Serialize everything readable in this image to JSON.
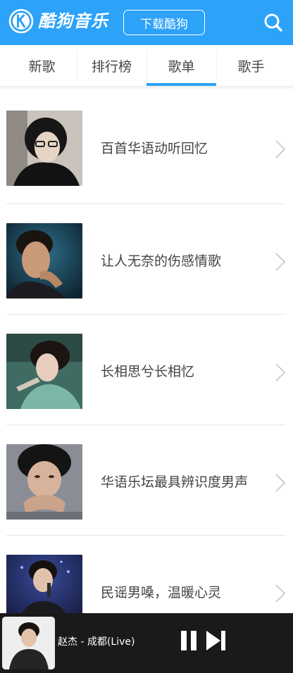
{
  "header": {
    "logo_text": "酷狗音乐",
    "download_label": "下载酷狗",
    "search_icon": "search-icon",
    "brand_color": "#2ca2f9"
  },
  "tabs": [
    {
      "label": "新歌",
      "active": false
    },
    {
      "label": "排行榜",
      "active": false
    },
    {
      "label": "歌单",
      "active": true
    },
    {
      "label": "歌手",
      "active": false
    }
  ],
  "playlists": [
    {
      "title": "百首华语动听回忆"
    },
    {
      "title": "让人无奈的伤感情歌"
    },
    {
      "title": "长相思兮长相忆"
    },
    {
      "title": "华语乐坛最具辨识度男声"
    },
    {
      "title": "民谣男嗓，温暖心灵"
    }
  ],
  "player": {
    "song": "赵杰 - 成都(Live)",
    "pause_icon": "pause-icon",
    "next_icon": "next-icon"
  }
}
